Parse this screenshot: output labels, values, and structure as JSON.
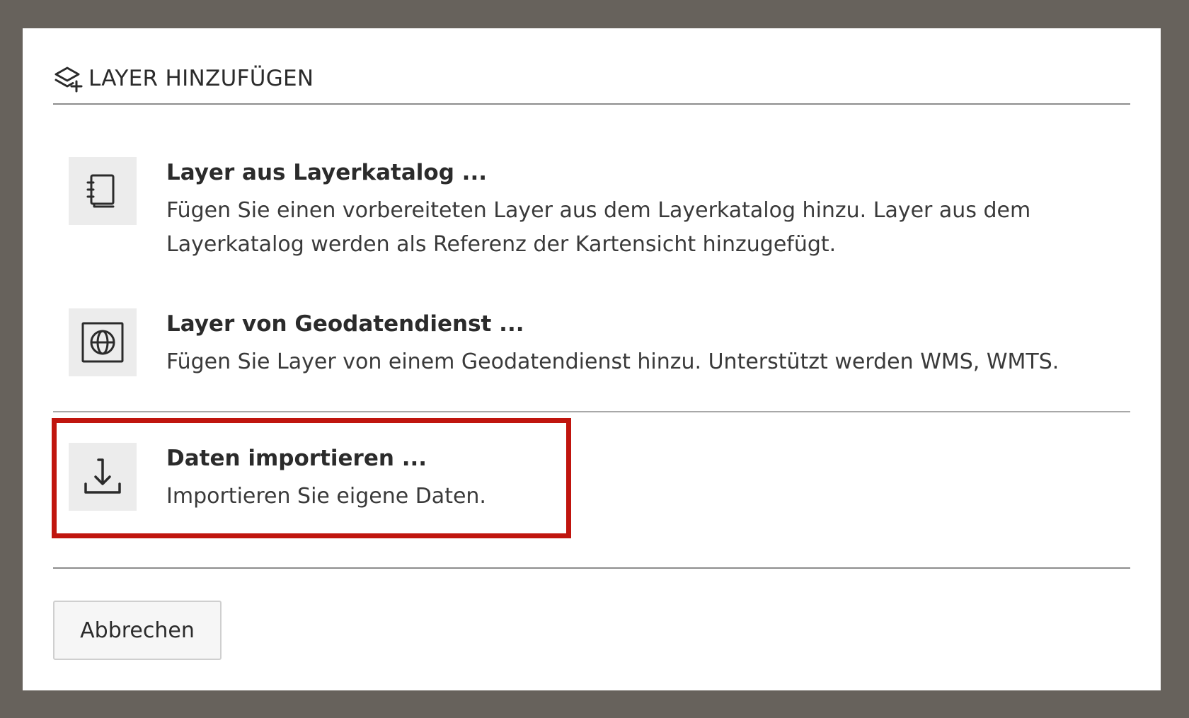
{
  "dialog": {
    "title": "LAYER HINZUFÜGEN",
    "title_icon": "layers-add-icon"
  },
  "options": [
    {
      "icon": "catalog-book-icon",
      "title": "Layer aus Layerkatalog ...",
      "description": "Fügen Sie einen vorbereiteten Layer aus dem Layerkatalog hinzu. Layer aus dem Layerkatalog werden als Referenz der Kartensicht hinzugefügt."
    },
    {
      "icon": "globe-service-icon",
      "title": "Layer von Geodatendienst ...",
      "description": "Fügen Sie Layer von einem Geodatendienst hinzu. Unterstützt werden WMS, WMTS."
    },
    {
      "icon": "import-download-icon",
      "title": "Daten importieren ...",
      "description": "Importieren Sie eigene Daten."
    }
  ],
  "footer": {
    "cancel_label": "Abbrechen"
  },
  "colors": {
    "backdrop": "#67625c",
    "highlight": "#c0150e",
    "icon_box": "#ececec"
  }
}
